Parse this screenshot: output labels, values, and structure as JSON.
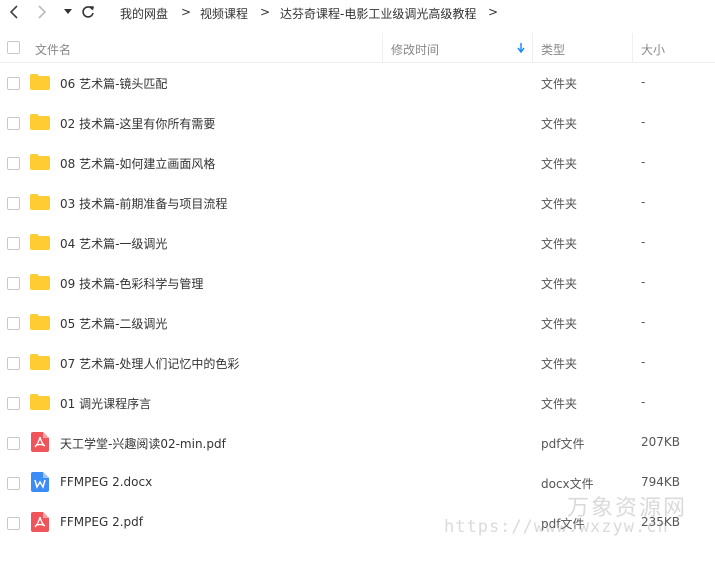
{
  "breadcrumb": {
    "items": [
      "我的网盘",
      "视频课程",
      "达芬奇课程-电影工业级调光高级教程"
    ],
    "separator": ">"
  },
  "columns": {
    "name": "文件名",
    "modified": "修改时间",
    "type": "类型",
    "size": "大小"
  },
  "colors": {
    "folder": "#ffcc33",
    "pdf": "#f0545b",
    "docx": "#3b8cf5",
    "sort_arrow": "#1a8cff",
    "watermark": "#999999"
  },
  "rows": [
    {
      "icon": "folder-icon",
      "name": "06 艺术篇-镜头匹配",
      "type": "文件夹",
      "size": "-"
    },
    {
      "icon": "folder-icon",
      "name": "02 技术篇-这里有你所有需要",
      "type": "文件夹",
      "size": "-"
    },
    {
      "icon": "folder-icon",
      "name": "08 艺术篇-如何建立画面风格",
      "type": "文件夹",
      "size": "-"
    },
    {
      "icon": "folder-icon",
      "name": "03 技术篇-前期准备与项目流程",
      "type": "文件夹",
      "size": "-"
    },
    {
      "icon": "folder-icon",
      "name": "04 艺术篇-一级调光",
      "type": "文件夹",
      "size": "-"
    },
    {
      "icon": "folder-icon",
      "name": "09 技术篇-色彩科学与管理",
      "type": "文件夹",
      "size": "-"
    },
    {
      "icon": "folder-icon",
      "name": "05 艺术篇-二级调光",
      "type": "文件夹",
      "size": "-"
    },
    {
      "icon": "folder-icon",
      "name": "07 艺术篇-处理人们记忆中的色彩",
      "type": "文件夹",
      "size": "-"
    },
    {
      "icon": "folder-icon",
      "name": "01 调光课程序言",
      "type": "文件夹",
      "size": "-"
    },
    {
      "icon": "pdf-file-icon",
      "name": "天工学堂-兴趣阅读02-min.pdf",
      "type": "pdf文件",
      "size": "207KB"
    },
    {
      "icon": "docx-file-icon",
      "name": "FFMPEG 2.docx",
      "type": "docx文件",
      "size": "794KB"
    },
    {
      "icon": "pdf-file-icon",
      "name": "FFMPEG 2.pdf",
      "type": "pdf文件",
      "size": "235KB"
    }
  ],
  "watermark": {
    "title": "万象资源网",
    "url": "https://www.wxzyw.cn"
  }
}
